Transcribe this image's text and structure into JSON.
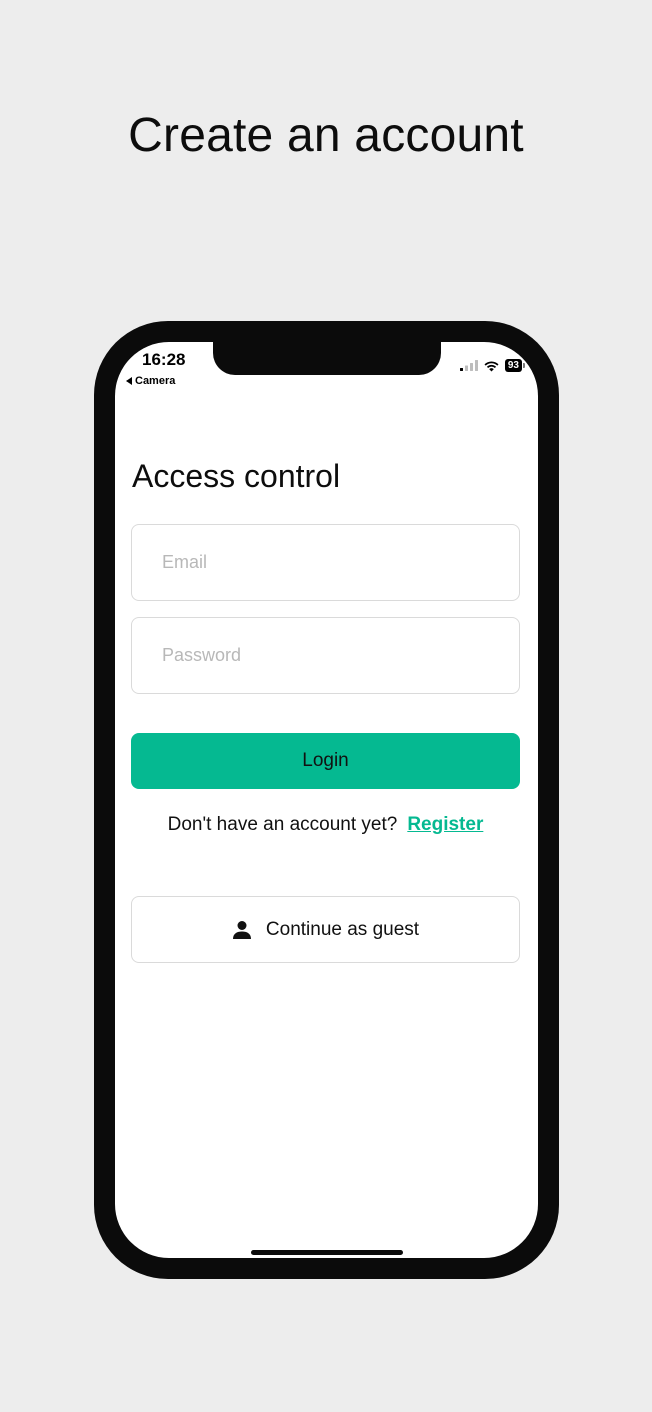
{
  "page": {
    "headline": "Create an account"
  },
  "status_bar": {
    "time": "16:28",
    "back_label": "Camera",
    "battery": "93"
  },
  "screen": {
    "title": "Access control",
    "email_placeholder": "Email",
    "password_placeholder": "Password",
    "login_label": "Login",
    "register_prompt": "Don't have an account yet?",
    "register_label": "Register",
    "guest_label": "Continue as guest"
  },
  "colors": {
    "accent": "#05b991",
    "background": "#ededed",
    "device": "#0b0b0b"
  },
  "icons": {
    "signal": "cellular-signal-icon",
    "wifi": "wifi-icon",
    "battery": "battery-icon",
    "back": "back-arrow-icon",
    "guest": "person-icon"
  }
}
